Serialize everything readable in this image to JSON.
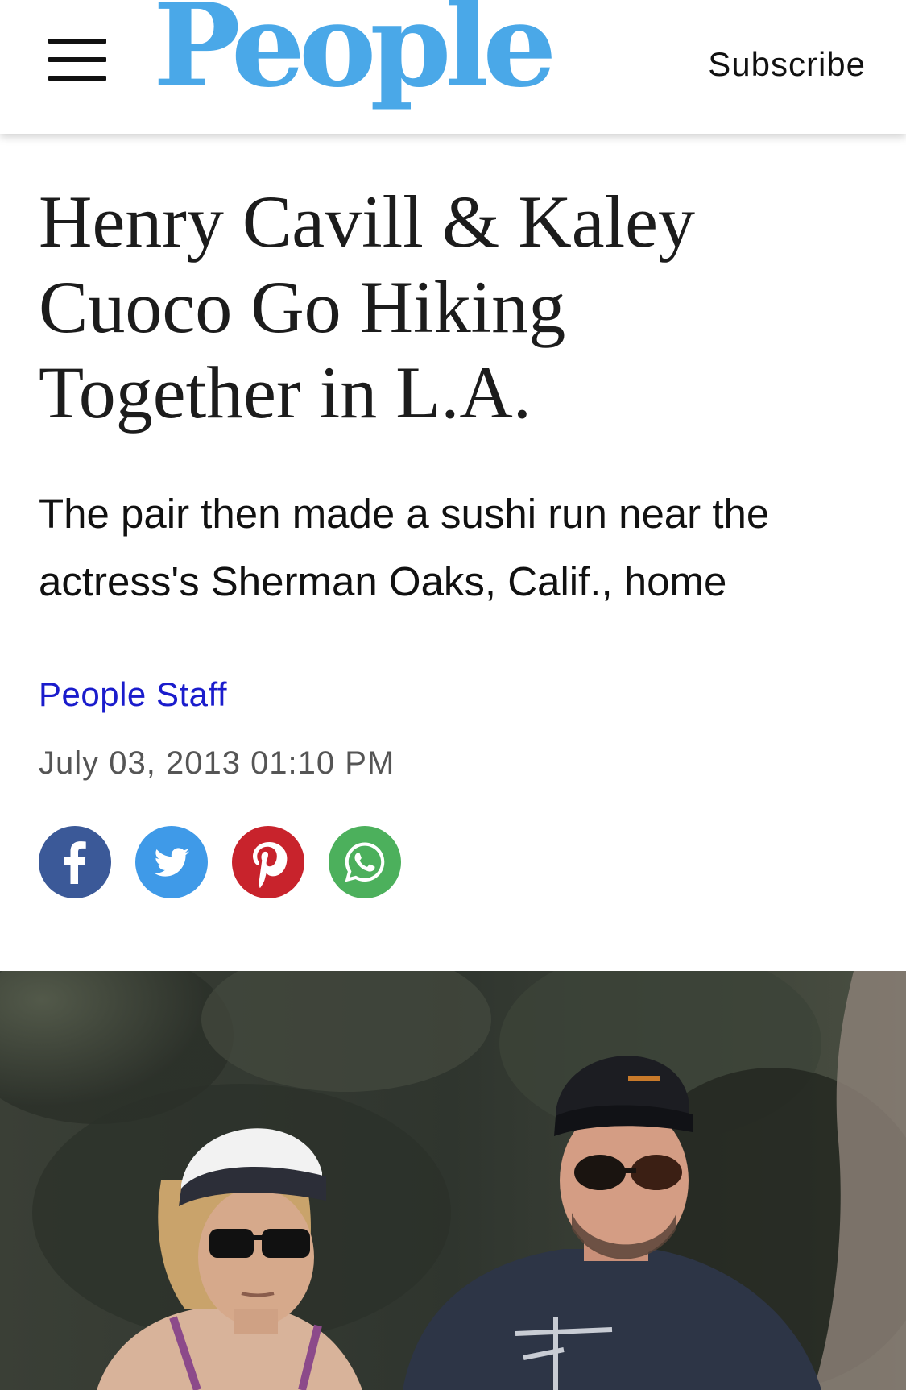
{
  "header": {
    "logo_text": "People",
    "subscribe_label": "Subscribe",
    "menu_icon": "hamburger-menu-icon"
  },
  "article": {
    "headline": "Henry Cavill & Kaley Cuoco Go Hiking Together in L.A.",
    "dek": "The pair then made a sushi run near the actress's Sherman Oaks, Calif., home",
    "byline": "People Staff",
    "date": "July 03, 2013 01:10 PM"
  },
  "share": [
    {
      "icon": "facebook-icon",
      "color": "#3b5998"
    },
    {
      "icon": "twitter-icon",
      "color": "#3f9ae8"
    },
    {
      "icon": "pinterest-icon",
      "color": "#c8232c"
    },
    {
      "icon": "whatsapp-icon",
      "color": "#4cb05c"
    }
  ],
  "colors": {
    "logo": "#4aa8e8",
    "byline_link": "#1a1ccc",
    "date_text": "#555555"
  }
}
